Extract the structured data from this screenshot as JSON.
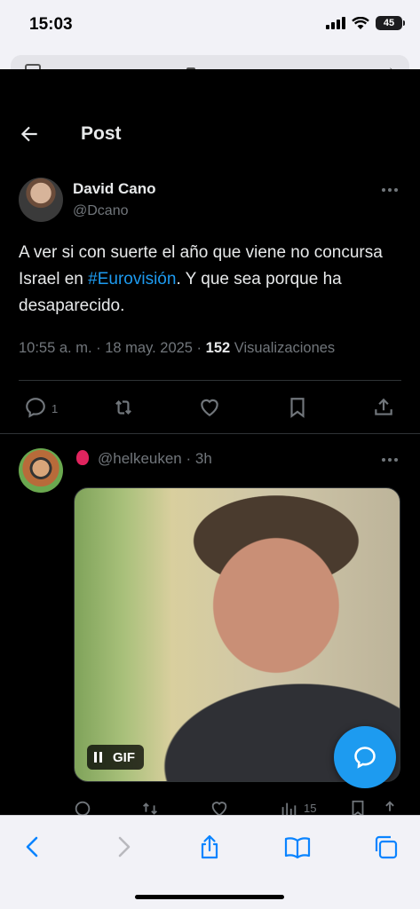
{
  "status_bar": {
    "time": "15:03",
    "battery": "45"
  },
  "topbar": {
    "title": "Post"
  },
  "tweet": {
    "author_name": "David Cano",
    "author_handle": "@Dcano",
    "text_before": "A ver si con suerte el año que viene no concursa Israel en ",
    "hashtag": "#Eurovisión",
    "text_after": ". Y que sea porque ha desaparecido.",
    "timestamp": "10:55 a. m. · 18 may. 2025 · ",
    "views": "152",
    "views_label": " Visualizaciones",
    "reply_count": "1"
  },
  "reply": {
    "handle": "@helkeuken",
    "time": " · 3h",
    "gif_label": "GIF",
    "views_count": "15"
  },
  "colors": {
    "accent": "#1d9bf0",
    "muted": "#71767b",
    "text": "#e7e9ea",
    "background": "#000000"
  },
  "icons": [
    "back-arrow-icon",
    "more-icon",
    "reply-icon",
    "retweet-icon",
    "like-icon",
    "bookmark-icon",
    "share-icon",
    "pause-icon",
    "compose-reply-icon",
    "safari-back-icon",
    "safari-forward-icon",
    "safari-share-icon",
    "safari-bookmarks-icon",
    "safari-tabs-icon"
  ]
}
